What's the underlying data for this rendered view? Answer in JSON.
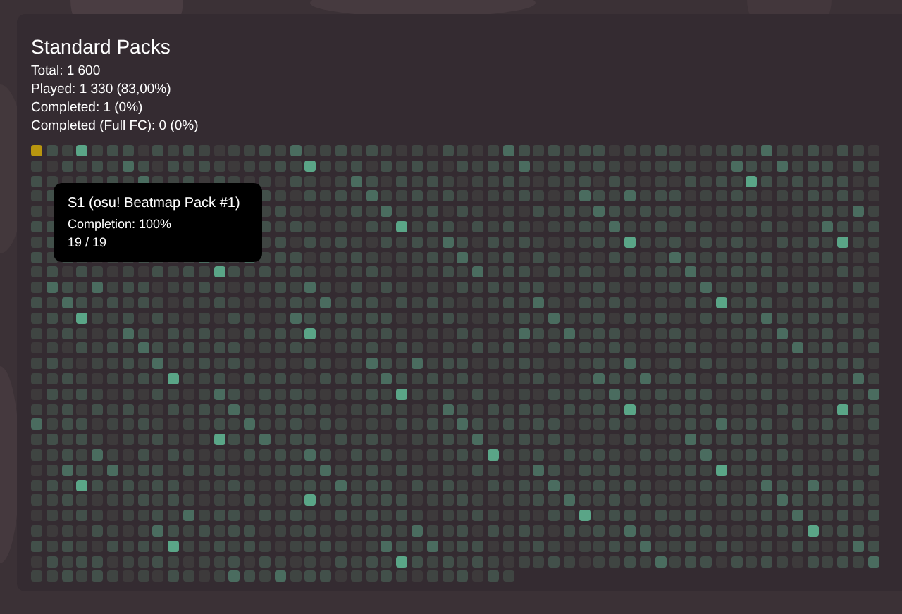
{
  "panel": {
    "title": "Standard Packs",
    "stats": [
      "Total: 1 600",
      "Played: 1 330 (83,00%)",
      "Completed: 1 (0%)",
      "Completed (Full FC): 0 (0%)"
    ]
  },
  "grid": {
    "first_cell_selected": true
  },
  "tooltip": {
    "title": "S1 (osu! Beatmap Pack #1)",
    "lines": [
      "Completion: 100%",
      "19 / 19"
    ]
  }
}
